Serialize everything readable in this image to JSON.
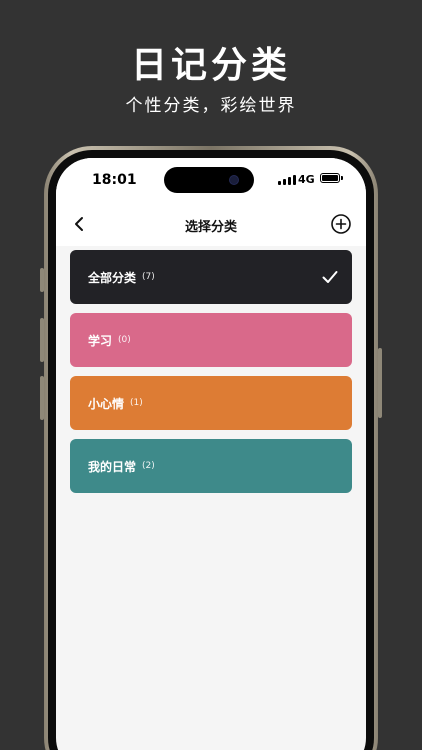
{
  "promo": {
    "title": "日记分类",
    "subtitle": "个性分类，彩绘世界"
  },
  "status_bar": {
    "time": "18:01",
    "network": "4G"
  },
  "nav": {
    "title": "选择分类",
    "back_icon": "chevron-left-icon",
    "add_icon": "plus-circle-icon"
  },
  "categories": [
    {
      "name": "全部分类",
      "count": "(7)",
      "color": "#222226",
      "selected": true
    },
    {
      "name": "学习",
      "count": "(0)",
      "color": "#d9698a",
      "selected": false
    },
    {
      "name": "小心情",
      "count": "(1)",
      "color": "#dd7c34",
      "selected": false
    },
    {
      "name": "我的日常",
      "count": "(2)",
      "color": "#3e8a8a",
      "selected": false
    }
  ]
}
